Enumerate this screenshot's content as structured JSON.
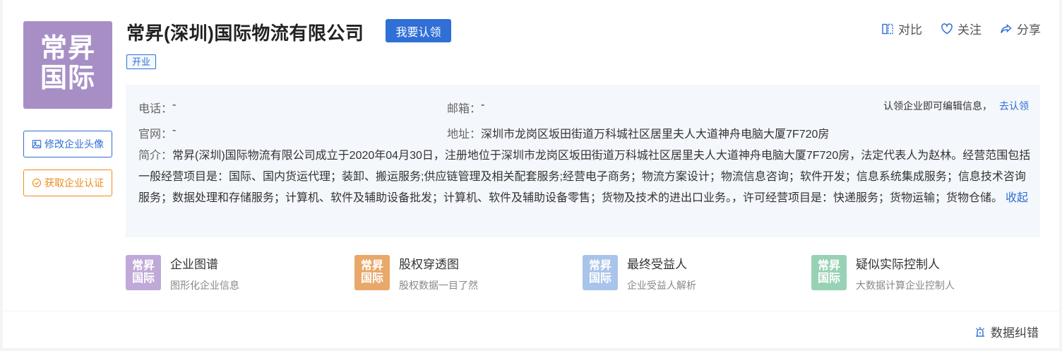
{
  "company": {
    "name": "常昇(深圳)国际物流有限公司",
    "logo_line1": "常昇",
    "logo_line2": "国际",
    "status": "开业",
    "claim_button": "我要认领",
    "logo_color": "#a78fc6"
  },
  "left_buttons": {
    "edit_avatar": "修改企业头像",
    "get_certification": "获取企业认证"
  },
  "actions": {
    "compare": "对比",
    "follow": "关注",
    "share": "分享"
  },
  "info": {
    "phone_label": "电话：",
    "phone_value": "-",
    "email_label": "邮箱：",
    "email_value": "-",
    "website_label": "官网：",
    "website_value": "-",
    "address_label": "地址：",
    "address_value": "深圳市龙岗区坂田街道万科城社区居里夫人大道神舟电脑大厦7F720房",
    "claim_tip": "认领企业即可编辑信息，",
    "claim_link": "去认领",
    "intro_label": "简介：",
    "intro_text": "常昇(深圳)国际物流有限公司成立于2020年04月30日，注册地位于深圳市龙岗区坂田街道万科城社区居里夫人大道神舟电脑大厦7F720房，法定代表人为赵林。经营范围包括一般经营项目是：国际、国内货运代理；装卸、搬运服务;供应链管理及相关配套服务;经营电子商务；物流方案设计；物流信息咨询；软件开发；信息系统集成服务；信息技术咨询服务；数据处理和存储服务；计算机、软件及辅助设备批发；计算机、软件及辅助设备零售；货物及技术的进出口业务。，许可经营项目是：快递服务；货物运输；货物仓储。",
    "collapse_link": "收起"
  },
  "tools": [
    {
      "title": "企业图谱",
      "subtitle": "图形化企业信息",
      "icon_line1": "常昇",
      "icon_line2": "国际",
      "color": "#bfa9d8"
    },
    {
      "title": "股权穿透图",
      "subtitle": "股权数据一目了然",
      "icon_line1": "常昇",
      "icon_line2": "国际",
      "color": "#e9a86a"
    },
    {
      "title": "最终受益人",
      "subtitle": "企业受益人解析",
      "icon_line1": "常昇",
      "icon_line2": "国际",
      "color": "#a9c4ea"
    },
    {
      "title": "疑似实际控制人",
      "subtitle": "大数据计算企业控制人",
      "icon_line1": "常昇",
      "icon_line2": "国际",
      "color": "#98d2b4"
    }
  ],
  "footer": {
    "feedback": "数据纠错"
  },
  "colors": {
    "accent": "#2f6fd6",
    "warning": "#f08b1b"
  }
}
